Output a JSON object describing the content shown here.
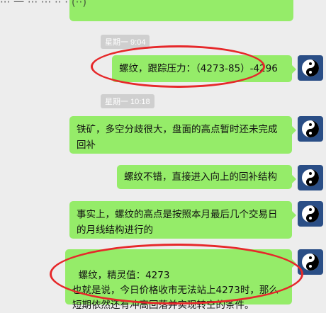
{
  "header": {
    "title": "··· 一 ··· ··· ·· · (··)"
  },
  "timestamps": {
    "t1": "星期一 9:04",
    "t2": "星期一 10:18"
  },
  "messages": [
    {
      "text": "螺纹，跟踪压力：（4273-85）-4296"
    },
    {
      "text": "铁矿，多空分歧很大，盘面的高点暂时还未完成回补"
    },
    {
      "text": "螺纹不错，直接进入向上的回补结构"
    },
    {
      "text": "事实上，螺纹的高点是按照本月最后几个交易日的月线结构进行的"
    },
    {
      "text": "螺纹，精灵值：4273\n也就是说，今日价格收市无法站上4273时，那么短期依然还有冲高回落并实现转空的条件。"
    }
  ],
  "colors": {
    "bubble": "#95ec69",
    "annotation": "#e6282a",
    "background": "#ededed",
    "avatar": "#2a4e86"
  },
  "icons": {
    "avatar": "yin-yang-icon"
  }
}
